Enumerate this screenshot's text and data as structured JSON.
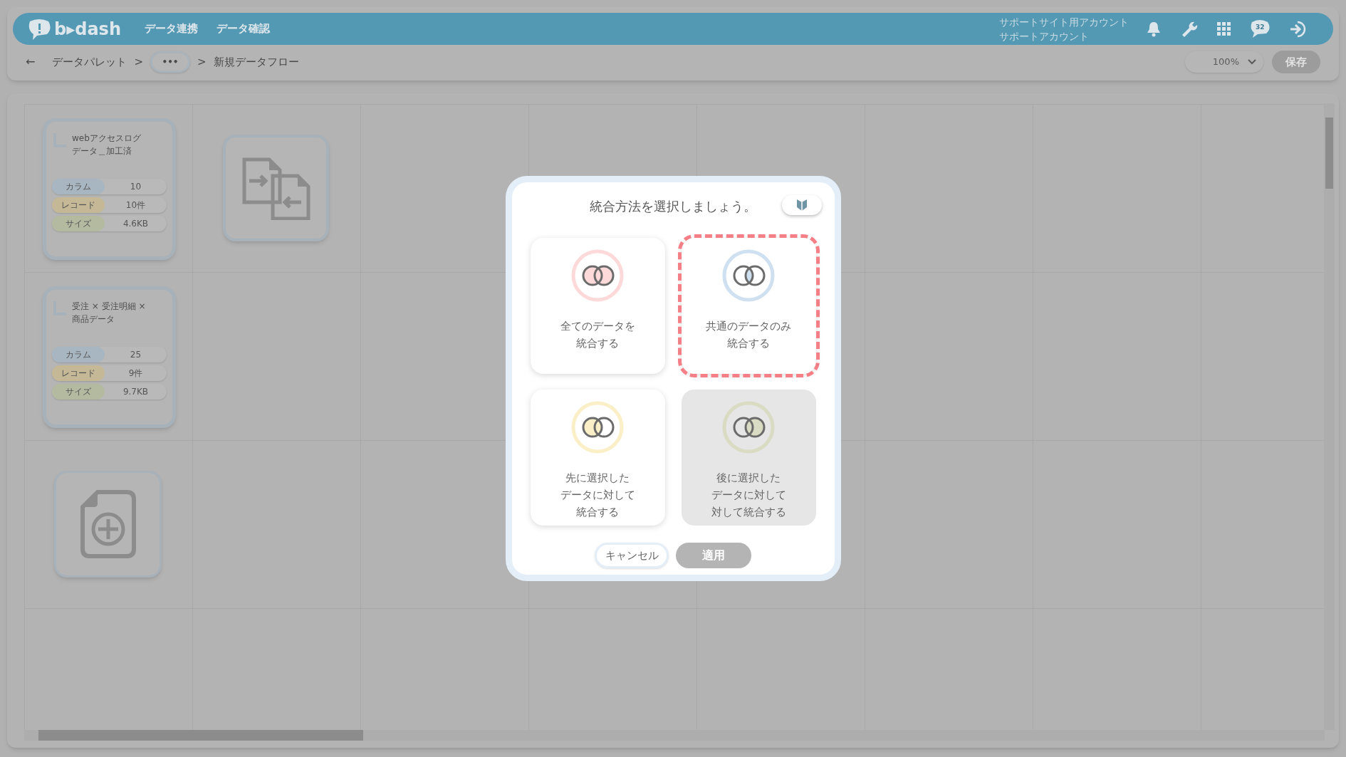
{
  "header": {
    "logo": "b▸dash",
    "nav": [
      "データ連携",
      "データ確認"
    ],
    "account": [
      "サポートサイト用アカウント",
      "サポートアカウント"
    ],
    "notification_count": "32"
  },
  "breadcrumb": {
    "back": "←",
    "items": [
      {
        "kind": "link",
        "label": "データパレット"
      },
      {
        "kind": "sep",
        "label": ">"
      },
      {
        "kind": "more",
        "label": "•••"
      },
      {
        "kind": "sep",
        "label": ">"
      },
      {
        "kind": "current",
        "label": "新規データフロー"
      }
    ]
  },
  "zoom": {
    "value": "100%"
  },
  "save_button": {
    "label": "保存",
    "disabled": true
  },
  "data_cards": [
    {
      "title_lines": [
        "webアクセスログ",
        "データ＿加工済"
      ],
      "stats": [
        {
          "label": "カラム",
          "value": "10",
          "color": "#a8b6c2"
        },
        {
          "label": "レコード",
          "value": "10件",
          "color": "#c4b896"
        },
        {
          "label": "サイズ",
          "value": "4.6KB",
          "color": "#b4baa0"
        }
      ]
    },
    {
      "title_lines": [
        "受注 × 受注明細 ×",
        "商品データ"
      ],
      "stats": [
        {
          "label": "カラム",
          "value": "25",
          "color": "#a8b6c2"
        },
        {
          "label": "レコード",
          "value": "9件",
          "color": "#c4b896"
        },
        {
          "label": "サイズ",
          "value": "9.7KB",
          "color": "#b4baa0"
        }
      ]
    }
  ],
  "dialog": {
    "title": "統合方法を選択しましょう。",
    "options": [
      {
        "kind": "union",
        "label_lines": [
          "全てのデータを",
          "統合する"
        ],
        "color": "#fdd9d9",
        "selected": false,
        "disabled": false
      },
      {
        "kind": "intersection",
        "label_lines": [
          "共通のデータのみ",
          "統合する"
        ],
        "color": "#cfe0f0",
        "selected": true,
        "disabled": false
      },
      {
        "kind": "left",
        "label_lines": [
          "先に選択した",
          "データに対して",
          "統合する"
        ],
        "color": "#fbefc8",
        "selected": false,
        "disabled": false
      },
      {
        "kind": "right",
        "label_lines": [
          "後に選択した",
          "データに対して",
          "対して統合する"
        ],
        "color": "#d9dcc2",
        "selected": false,
        "disabled": true
      }
    ],
    "cancel": "キャンセル",
    "apply": {
      "label": "適用",
      "disabled": true
    }
  }
}
